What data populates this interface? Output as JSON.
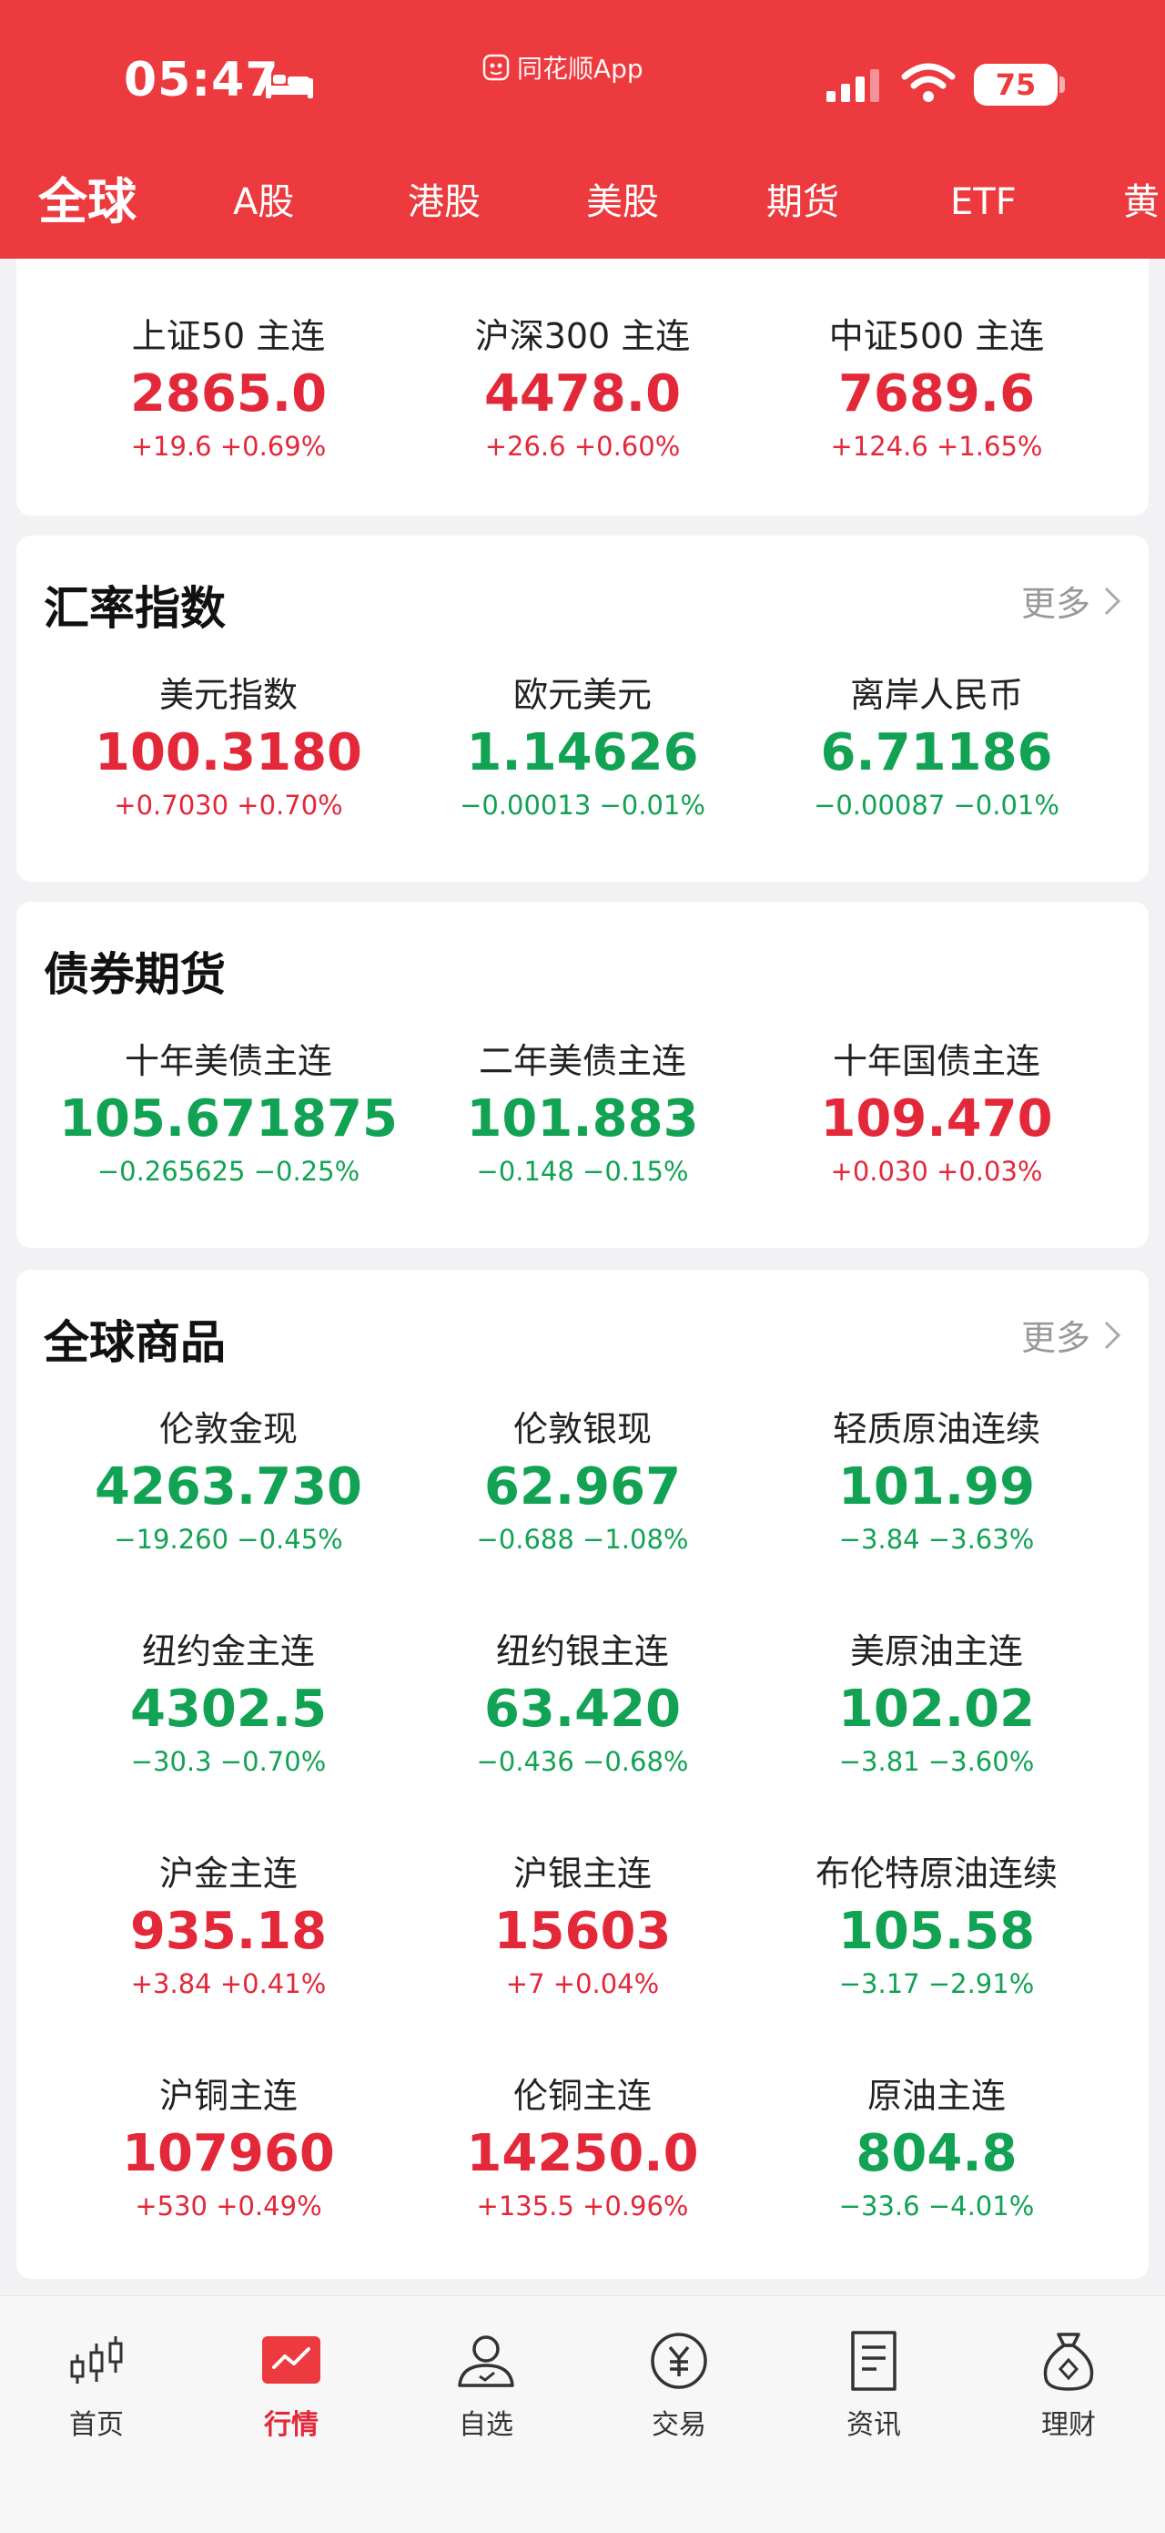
{
  "status_bar": {
    "time": "05:47",
    "app_name": "同花顺App",
    "battery": "75"
  },
  "tabs": [
    "全球",
    "A股",
    "港股",
    "美股",
    "期货",
    "ETF",
    "黄"
  ],
  "index_futures": {
    "items": [
      {
        "name": "上证50 主连",
        "price": "2865.0",
        "change": "+19.6 +0.69%",
        "dir": "up"
      },
      {
        "name": "沪深300 主连",
        "price": "4478.0",
        "change": "+26.6 +0.60%",
        "dir": "up"
      },
      {
        "name": "中证500 主连",
        "price": "7689.6",
        "change": "+124.6 +1.65%",
        "dir": "up"
      }
    ]
  },
  "fx": {
    "title": "汇率指数",
    "more": "更多",
    "items": [
      {
        "name": "美元指数",
        "price": "100.3180",
        "change": "+0.7030 +0.70%",
        "dir": "up"
      },
      {
        "name": "欧元美元",
        "price": "1.14626",
        "change": "−0.00013 −0.01%",
        "dir": "down"
      },
      {
        "name": "离岸人民币",
        "price": "6.71186",
        "change": "−0.00087 −0.01%",
        "dir": "down"
      }
    ]
  },
  "bonds": {
    "title": "债券期货",
    "items": [
      {
        "name": "十年美债主连",
        "price": "105.671875",
        "change": "−0.265625 −0.25%",
        "dir": "down"
      },
      {
        "name": "二年美债主连",
        "price": "101.883",
        "change": "−0.148 −0.15%",
        "dir": "down"
      },
      {
        "name": "十年国债主连",
        "price": "109.470",
        "change": "+0.030 +0.03%",
        "dir": "up"
      }
    ]
  },
  "commodities": {
    "title": "全球商品",
    "more": "更多",
    "items": [
      {
        "name": "伦敦金现",
        "price": "4263.730",
        "change": "−19.260 −0.45%",
        "dir": "down"
      },
      {
        "name": "伦敦银现",
        "price": "62.967",
        "change": "−0.688 −1.08%",
        "dir": "down"
      },
      {
        "name": "轻质原油连续",
        "price": "101.99",
        "change": "−3.84 −3.63%",
        "dir": "down"
      },
      {
        "name": "纽约金主连",
        "price": "4302.5",
        "change": "−30.3 −0.70%",
        "dir": "down"
      },
      {
        "name": "纽约银主连",
        "price": "63.420",
        "change": "−0.436 −0.68%",
        "dir": "down"
      },
      {
        "name": "美原油主连",
        "price": "102.02",
        "change": "−3.81 −3.60%",
        "dir": "down"
      },
      {
        "name": "沪金主连",
        "price": "935.18",
        "change": "+3.84 +0.41%",
        "dir": "up"
      },
      {
        "name": "沪银主连",
        "price": "15603",
        "change": "+7 +0.04%",
        "dir": "up"
      },
      {
        "name": "布伦特原油连续",
        "price": "105.58",
        "change": "−3.17 −2.91%",
        "dir": "down"
      },
      {
        "name": "沪铜主连",
        "price": "107960",
        "change": "+530 +0.49%",
        "dir": "up"
      },
      {
        "name": "伦铜主连",
        "price": "14250.0",
        "change": "+135.5 +0.96%",
        "dir": "up"
      },
      {
        "name": "原油主连",
        "price": "804.8",
        "change": "−33.6 −4.01%",
        "dir": "down"
      }
    ]
  },
  "bottom_nav": [
    {
      "label": "首页",
      "icon": "candlestick-icon"
    },
    {
      "label": "行情",
      "icon": "market-chart-icon",
      "active": true
    },
    {
      "label": "自选",
      "icon": "user-watchlist-icon"
    },
    {
      "label": "交易",
      "icon": "yuan-coin-icon"
    },
    {
      "label": "资讯",
      "icon": "news-document-icon"
    },
    {
      "label": "理财",
      "icon": "money-bag-icon"
    }
  ],
  "colors": {
    "brand_red": "#ec3a3f",
    "up": "#e3283a",
    "down": "#12a254"
  }
}
